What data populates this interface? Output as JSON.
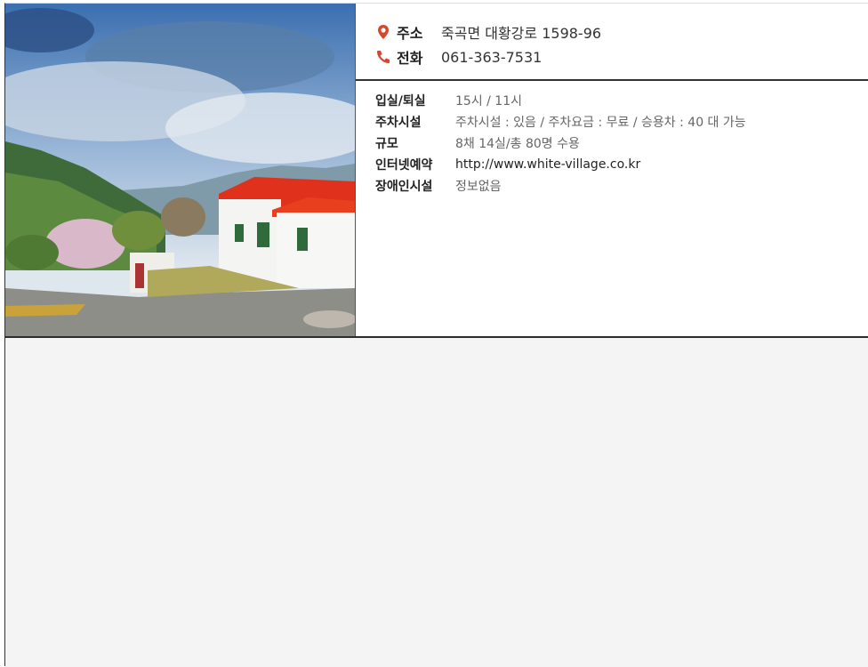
{
  "contact": {
    "address_label": "주소",
    "address_value": "죽곡면 대황강로 1598-96",
    "phone_label": "전화",
    "phone_value": "061-363-7531"
  },
  "details": [
    {
      "label": "입실/퇴실",
      "value": "15시 / 11시"
    },
    {
      "label": "주차시설",
      "value": "주차시설 : 있음 / 주차요금 : 무료 / 승용차 : 40 대 가능"
    },
    {
      "label": "규모",
      "value": "8채 14실/총 80명 수용"
    },
    {
      "label": "인터넷예약",
      "value": "http://www.white-village.co.kr"
    },
    {
      "label": "장애인시설",
      "value": "정보없음"
    }
  ],
  "colors": {
    "icon_accent": "#d9472b",
    "roof_red": "#e0311c"
  },
  "icons": {
    "address": "map-pin-icon",
    "phone": "phone-icon"
  }
}
